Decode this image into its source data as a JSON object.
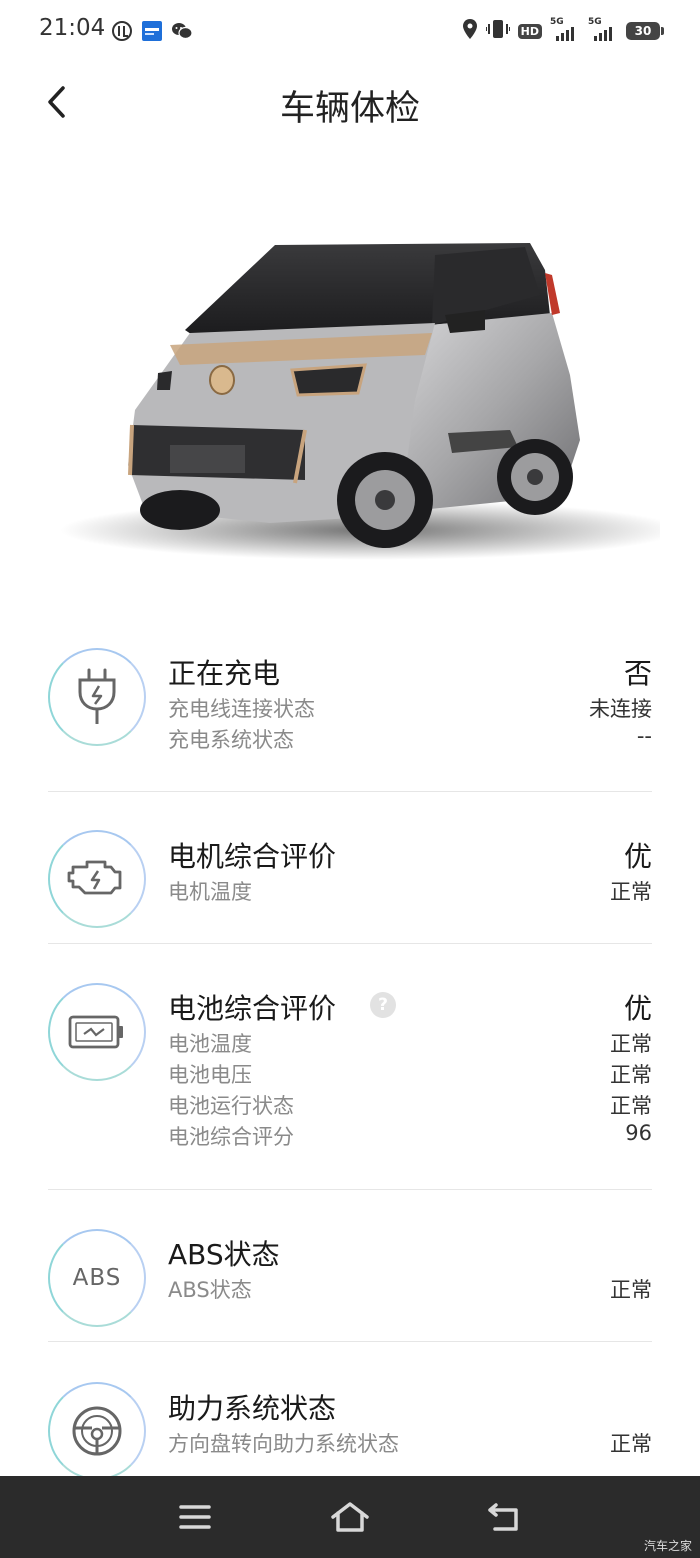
{
  "status_bar": {
    "time": "21:04",
    "left_icons": [
      "screen-record-icon",
      "app-badge-icon",
      "wechat-icon"
    ],
    "right_icons": [
      "location-icon",
      "vibrate-icon",
      "hd-icon",
      "signal-5g-icon",
      "signal-5g-icon",
      "battery-icon"
    ],
    "hd_label": "HD",
    "net1_label": "5G",
    "net2_label": "5G",
    "battery_level": "30"
  },
  "header": {
    "title": "车辆体检",
    "back_icon": "chevron-left-icon"
  },
  "car_image": {
    "icon": "car-illustration",
    "body_color": "#a9a9ab",
    "accent_color": "#c8a47e"
  },
  "sections": {
    "charging": {
      "icon": "plug-icon",
      "title": "正在充电",
      "value": "否",
      "items": [
        {
          "label": "充电线连接状态",
          "value": "未连接"
        },
        {
          "label": "充电系统状态",
          "value": "--"
        }
      ]
    },
    "motor": {
      "icon": "engine-icon",
      "title": "电机综合评价",
      "value": "优",
      "items": [
        {
          "label": "电机温度",
          "value": "正常"
        }
      ]
    },
    "battery": {
      "icon": "battery-health-icon",
      "title": "电池综合评价",
      "help": "?",
      "value": "优",
      "items": [
        {
          "label": "电池温度",
          "value": "正常"
        },
        {
          "label": "电池电压",
          "value": "正常"
        },
        {
          "label": "电池运行状态",
          "value": "正常"
        },
        {
          "label": "电池综合评分",
          "value": "96"
        }
      ]
    },
    "abs": {
      "icon_text": "ABS",
      "title": "ABS状态",
      "items": [
        {
          "label": "ABS状态",
          "value": "正常"
        }
      ]
    },
    "steering": {
      "icon": "steering-wheel-icon",
      "title": "助力系统状态",
      "items": [
        {
          "label": "方向盘转向助力系统状态",
          "value": "正常"
        }
      ]
    }
  },
  "nav_bar": {
    "icons": [
      "menu-icon",
      "home-icon",
      "back-icon"
    ]
  },
  "watermark": "汽车之家",
  "colors": {
    "ring": "#9fd8e8",
    "title_text": "#1a1a1a",
    "sub_text": "#8a8a8a",
    "nav_bg": "#2b2b2b"
  }
}
